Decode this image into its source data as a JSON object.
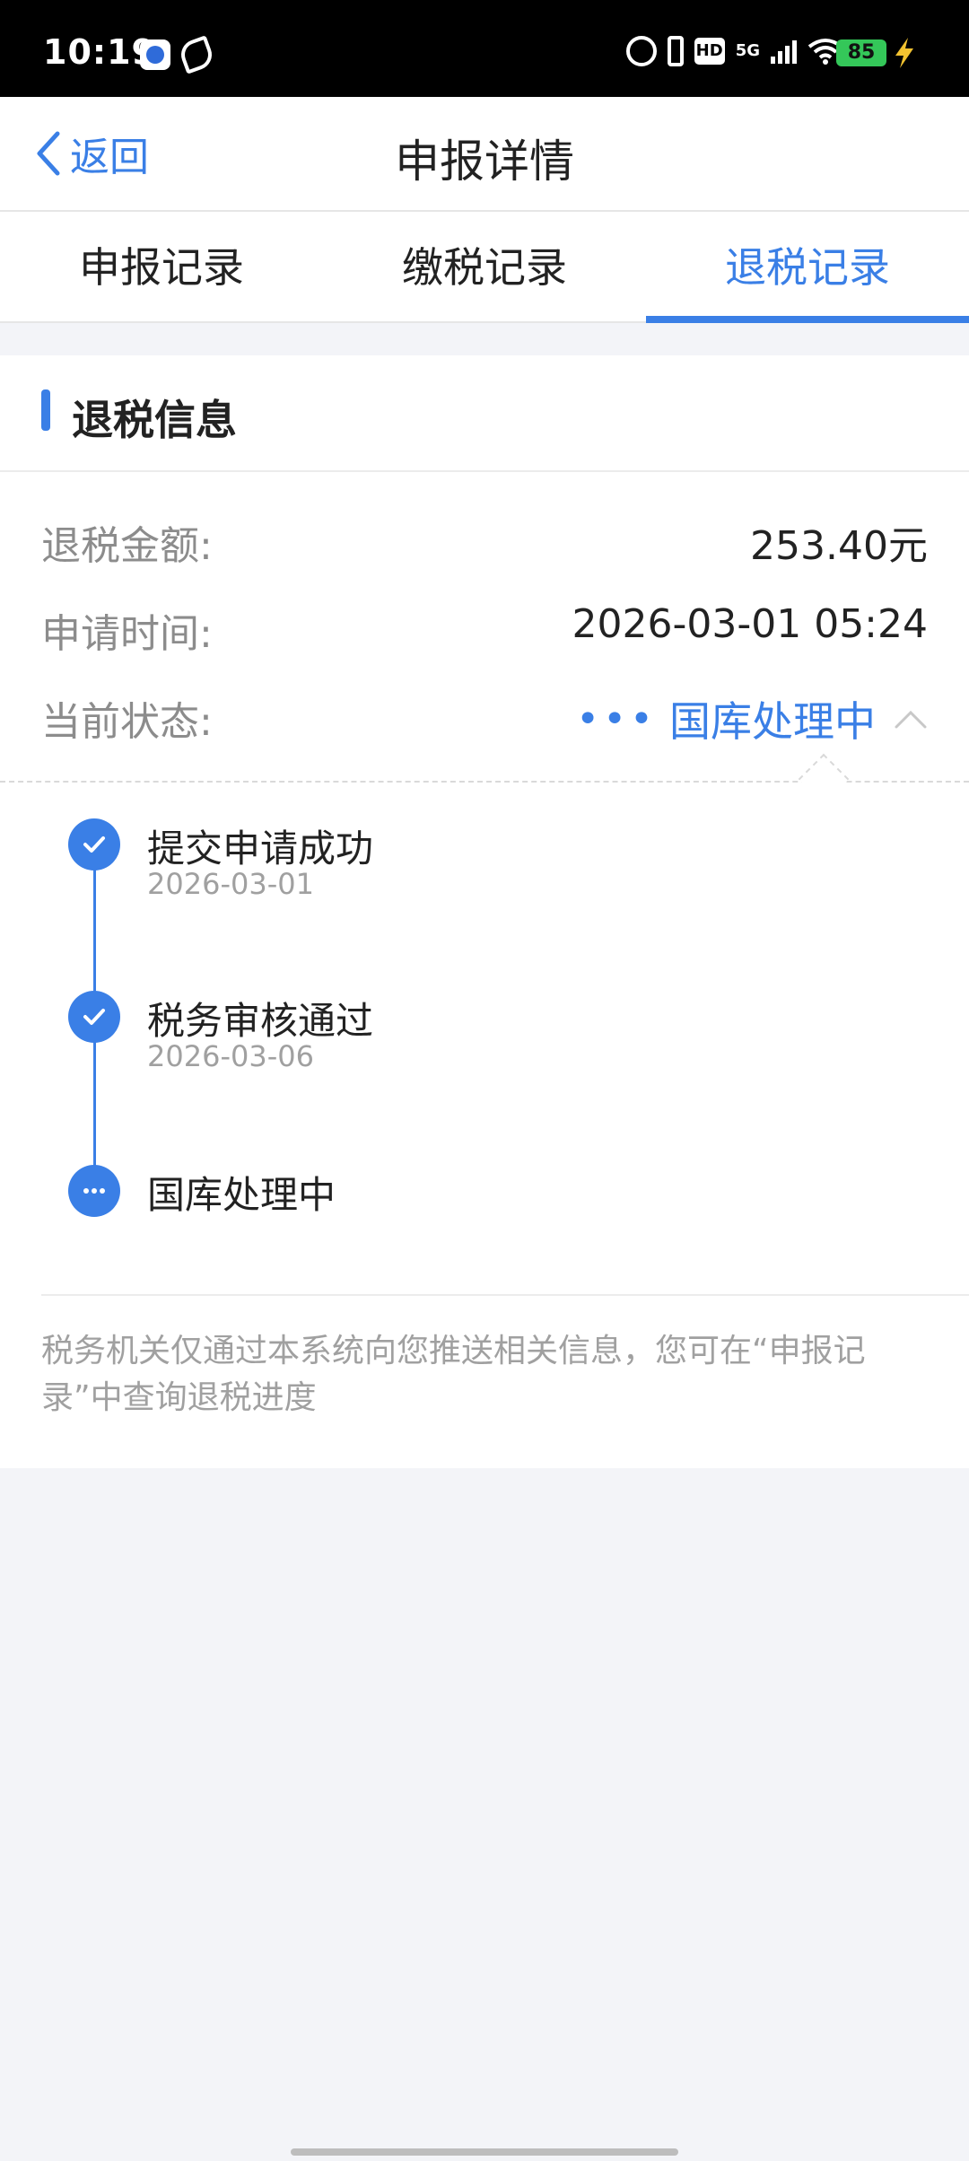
{
  "status_bar": {
    "time": "10:19",
    "network": "5G",
    "hd": "HD",
    "battery": "85",
    "icons": [
      "baidu-app-icon",
      "leaf-app-icon",
      "alarm-icon",
      "vibrate-icon",
      "hd-icon",
      "signal-icon",
      "wifi-icon",
      "battery-icon",
      "charging-icon"
    ]
  },
  "nav": {
    "back_label": "返回",
    "title": "申报详情"
  },
  "tabs": [
    {
      "label": "申报记录",
      "active": false
    },
    {
      "label": "缴税记录",
      "active": false
    },
    {
      "label": "退税记录",
      "active": true
    }
  ],
  "refund_info": {
    "section_title": "退税信息",
    "amount_label": "退税金额:",
    "amount_value": "253.40元",
    "time_label": "申请时间:",
    "time_value": "2026-03-01 05:24",
    "status_label": "当前状态:",
    "status_dots": "•••",
    "status_value": "国库处理中"
  },
  "timeline": [
    {
      "title": "提交申请成功",
      "date": "2026-03-01",
      "icon": "check-icon"
    },
    {
      "title": "税务审核通过",
      "date": "2026-03-06",
      "icon": "check-icon"
    },
    {
      "title": "国库处理中",
      "date": "",
      "icon": "dots-icon"
    }
  ],
  "notice": "税务机关仅通过本系统向您推送相关信息，您可在“申报记录”中查询退税进度",
  "colors": {
    "accent": "#3a7fe6",
    "background": "#f3f4f8",
    "muted_text": "#8c8c8c",
    "battery": "#34c759"
  }
}
